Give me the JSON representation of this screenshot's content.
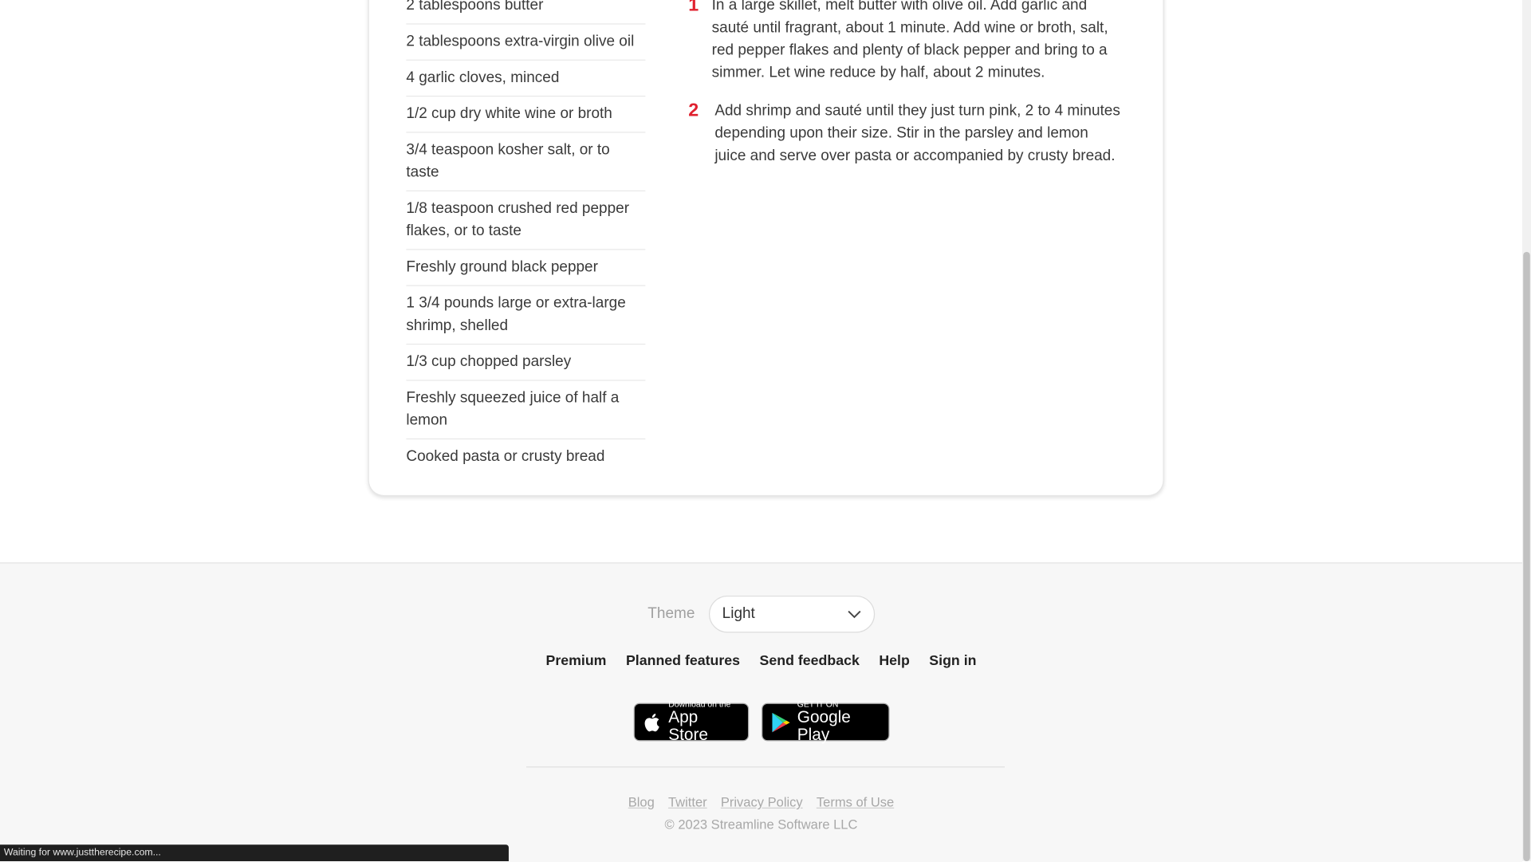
{
  "ingredients": [
    "2 tablespoons butter",
    "2 tablespoons extra-virgin olive oil",
    "4 garlic cloves, minced",
    "1/2 cup dry white wine or broth",
    "3/4 teaspoon kosher salt, or to taste",
    "1/8 teaspoon crushed red pepper flakes, or to taste",
    "Freshly ground black pepper",
    "1 3/4 pounds large or extra-large shrimp, shelled",
    "1/3 cup chopped parsley",
    "Freshly squeezed juice of half a lemon",
    "Cooked pasta or crusty bread"
  ],
  "steps": [
    {
      "number": "1",
      "text": "In a large skillet, melt butter with olive oil. Add garlic and sauté until fragrant, about 1 minute. Add wine or broth, salt, red pepper flakes and plenty of black pepper and bring to a simmer. Let wine reduce by half, about 2 minutes."
    },
    {
      "number": "2",
      "text": "Add shrimp and sauté until they just turn pink, 2 to 4 minutes depending upon their size. Stir in the parsley and lemon juice and serve over pasta or accompanied by crusty bread."
    }
  ],
  "footer": {
    "theme_label": "Theme",
    "theme_value": "Light",
    "links": [
      "Premium",
      "Planned features",
      "Send feedback",
      "Help",
      "Sign in"
    ],
    "app_store": {
      "small": "Download on the",
      "big": "App Store"
    },
    "google_play": {
      "small": "GET IT ON",
      "big": "Google Play"
    },
    "legal_links": [
      "Blog",
      "Twitter",
      "Privacy Policy",
      "Terms of Use"
    ],
    "copyright": "© 2023 Streamline Software LLC"
  },
  "status_bar": "Waiting for www.justtherecipe.com...",
  "colors": {
    "accent": "#e0212f",
    "footer_bg": "#f7f7f7"
  }
}
